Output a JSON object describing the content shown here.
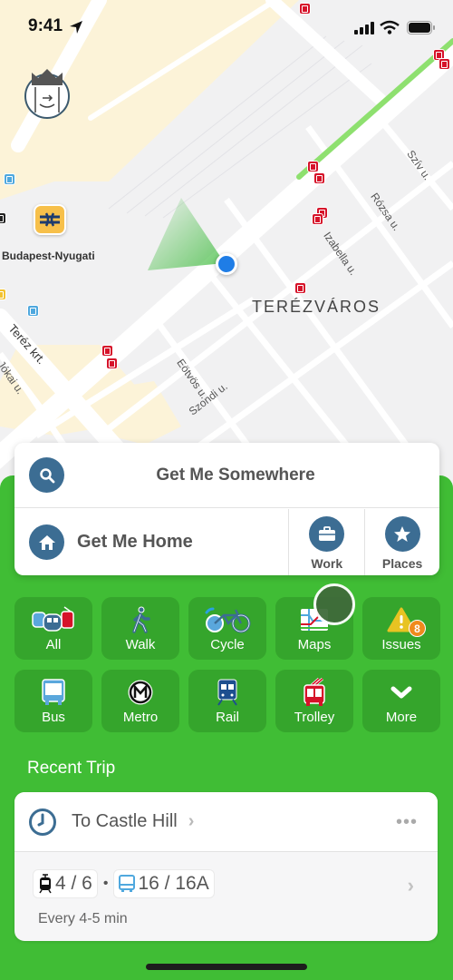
{
  "status_bar": {
    "time": "9:41",
    "icons": [
      "location-arrow-icon",
      "cellular-signal-icon",
      "wifi-icon",
      "battery-icon"
    ]
  },
  "map": {
    "district_label": "TERÉZVÁROS",
    "station_label": "Budapest-Nyugati",
    "street_labels": [
      "Teréz krt.",
      "Jókai u.",
      "Eötvös u.",
      "Szondi u.",
      "Izabella u.",
      "Rózsa u.",
      "Szív u."
    ],
    "colors": {
      "land": "#f1f1f2",
      "park": "#fcf3d8",
      "road": "#ffffff",
      "green_line": "#8ee06f",
      "tram_pin": "#d6132a",
      "bus_pin": "#4fa8de",
      "location_dot": "#1f7de6"
    }
  },
  "search_card": {
    "get_me_somewhere": "Get Me Somewhere",
    "get_me_home": "Get Me Home",
    "work": "Work",
    "places": "Places"
  },
  "modes": [
    {
      "label": "All",
      "icon": "all-transit-icon"
    },
    {
      "label": "Walk",
      "icon": "walk-icon"
    },
    {
      "label": "Cycle",
      "icon": "bicycle-icon"
    },
    {
      "label": "Maps",
      "icon": "transit-map-icon"
    },
    {
      "label": "Issues",
      "icon": "warning-icon",
      "badge": "8"
    },
    {
      "label": "Bus",
      "icon": "bus-icon"
    },
    {
      "label": "Metro",
      "icon": "metro-icon"
    },
    {
      "label": "Rail",
      "icon": "rail-icon"
    },
    {
      "label": "Trolley",
      "icon": "trolleybus-icon"
    },
    {
      "label": "More",
      "icon": "chevron-down-icon"
    }
  ],
  "recent_trip": {
    "section_title": "Recent Trip",
    "destination": "To Castle Hill",
    "lines": [
      {
        "mode": "tram",
        "label": "4 / 6"
      },
      {
        "mode": "bus",
        "label": "16 / 16A"
      }
    ],
    "separator": "•",
    "frequency": "Every 4-5 min",
    "more": "•••"
  },
  "colors": {
    "sheet_green": "#40bd35",
    "tile_green": "#35a52c",
    "accent_blue": "#3c6d93",
    "badge_orange": "#f08a1d"
  }
}
